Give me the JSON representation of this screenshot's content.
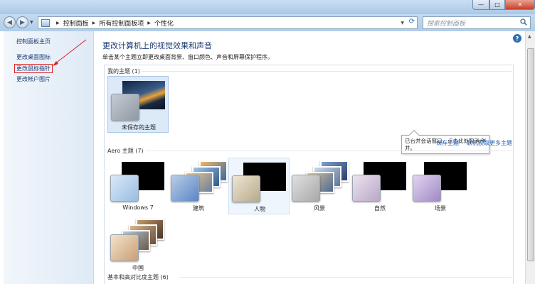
{
  "window": {
    "minimize_glyph": "—",
    "maximize_glyph": "□",
    "close_glyph": "✕"
  },
  "address": {
    "crumbs": [
      "控制面板",
      "所有控制面板项",
      "个性化"
    ],
    "search_placeholder": "搜索控制面板"
  },
  "nav": {
    "items": [
      "控制面板主页",
      "更改桌面图标",
      "更改鼠标指针",
      "更改帐户图片"
    ]
  },
  "main": {
    "title": "更改计算机上的视觉效果和声音",
    "description": "单击某个主题立即更改桌面背景、窗口颜色、声音和屏幕保护程序。",
    "help_glyph": "?"
  },
  "sections": {
    "my_themes": "我的主题 (1)",
    "aero_themes": "Aero 主题 (7)",
    "basic_themes": "基本和高对比度主题 (6)"
  },
  "tooltip": {
    "text": "已合并会话窗口，点击此处取消合并。",
    "close": "×"
  },
  "links": {
    "save_theme": "保存主题",
    "get_more": "联机获取更多主题"
  },
  "themes": {
    "unsaved": "未保存的主题",
    "aero": [
      "Windows 7",
      "建筑",
      "人物",
      "风景",
      "自然",
      "场景",
      "中国"
    ]
  },
  "colors": {
    "accent": "#1e5cb3",
    "nav_text": "#1b3a73",
    "selection": "#dce9f7"
  }
}
